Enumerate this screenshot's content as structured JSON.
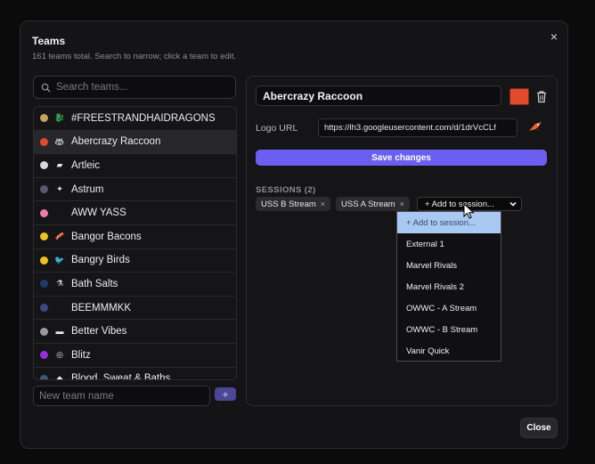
{
  "modal": {
    "title": "Teams",
    "subtitle": "161 teams total. Search to narrow; click a team to edit.",
    "close_label": "Close",
    "close_icon": "×"
  },
  "search": {
    "placeholder": "Search teams...",
    "value": ""
  },
  "teams": [
    {
      "name": "#FREESTRANDHAIDRAGONS",
      "color": "#c8a25a",
      "logo": "dragon-logo",
      "glyph": "🐉"
    },
    {
      "name": "Abercrazy Raccoon",
      "color": "#e14a2a",
      "logo": "raccoon-logo",
      "glyph": "🦝",
      "selected": true
    },
    {
      "name": "Artleic",
      "color": "#d9d9db",
      "logo": "artleic-logo",
      "glyph": "▰"
    },
    {
      "name": "Astrum",
      "color": "#5a5872",
      "logo": "astrum-logo",
      "glyph": "✦"
    },
    {
      "name": "AWW YASS",
      "color": "#f07ba8",
      "logo": "",
      "glyph": ""
    },
    {
      "name": "Bangor Bacons",
      "color": "#f2c21b",
      "logo": "bacon-logo",
      "glyph": "🥓"
    },
    {
      "name": "Bangry Birds",
      "color": "#f2c21b",
      "logo": "bird-logo",
      "glyph": "🐦"
    },
    {
      "name": "Bath Salts",
      "color": "#1c3a6a",
      "logo": "bathsalts-logo",
      "glyph": "⚗"
    },
    {
      "name": "BEEMMMKK",
      "color": "#3a4a86",
      "logo": "",
      "glyph": ""
    },
    {
      "name": "Better Vibes",
      "color": "#9a9aa0",
      "logo": "vibes-logo",
      "glyph": "▬"
    },
    {
      "name": "Blitz",
      "color": "#9a2ce0",
      "logo": "blitz-logo",
      "glyph": "◎"
    },
    {
      "name": "Blood, Sweat & Baths",
      "color": "#3a5a7a",
      "logo": "bsb-logo",
      "glyph": "◆"
    }
  ],
  "new_team": {
    "placeholder": "New team name",
    "add_label": "+"
  },
  "editor": {
    "team_name": "Abercrazy Raccoon",
    "team_color": "#e14a2a",
    "logo_label": "Logo URL",
    "logo_url": "https://lh3.googleusercontent.com/d/1drVcCLf",
    "save_label": "Save changes",
    "sessions_label": "SESSIONS (2)",
    "sessions": [
      "USS B Stream",
      "USS A Stream"
    ],
    "remove_glyph": "×",
    "add_session_label": "+ Add to session..."
  },
  "dropdown": {
    "options": [
      "+ Add to session...",
      "External 1",
      "Marvel Rivals",
      "Marvel Rivals 2",
      "OWWC - A Stream",
      "OWWC - B Stream",
      "Vanir Quick"
    ],
    "highlighted": 0
  }
}
